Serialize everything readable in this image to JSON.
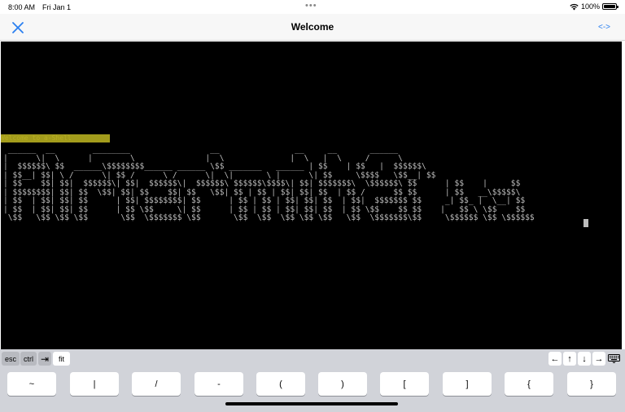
{
  "status_bar": {
    "time": "8:00 AM",
    "date": "Fri Jan 1",
    "battery": "100%"
  },
  "nav": {
    "title": "Welcome",
    "right_action": "<->"
  },
  "terminal": {
    "highlight_text": "Welcome to a-Shell",
    "ascii_art": [
      " ______  __        ________                 __                __     __       ______  ",
      "|      \\|  \\      |        \\               |  \\              |  \\   |  \\     /      \\ ",
      "|  $$$$$$\\ $$  ______\\$$$$$$$$______ ______ \\$$ _______   ______ | $$    | $$   |  $$$$$$\\",
      "| $$__| $$| \\ /      \\| $$ /      \\ /      \\|  \\|       \\ |      \\| $$     \\$$$$   \\$$__| $$",
      "| $$    $$| $$|  $$$$$$\\| $$|  $$$$$$\\|  $$$$$$\\ $$$$$$\\$$$$\\| $$| $$$$$$$\\  \\$$$$$$\\ $$      | $$    |     $$",
      "| $$$$$$$$| $$| $$  \\$$| $$| $$    $$| $$   \\$$| $$ | $$ | $$| $$| $$  | $$ /      $$ $$      | $$   __\\$$$$$\\",
      "| $$  | $$| $$| $$      | $$| $$$$$$$$| $$      | $$ | $$ | $$| $$| $$  | $$|  $$$$$$$ $$     _| $$_ |  \\__| $$",
      "| $$  | $$| $$| $$      | $$ \\$$     \\| $$      | $$ | $$ | $$| $$| $$  | $$ \\$$    $$ $$    |   $$ \\ \\$$    $$",
      " \\$$   \\$$ \\$$ \\$$       \\$$  \\$$$$$$$ \\$$       \\$$  \\$$  \\$$ \\$$ \\$$   \\$$  \\$$$$$$$\\$$     \\$$$$$$ \\$$ \\$$$$$$"
    ]
  },
  "accessory": {
    "esc": "esc",
    "ctrl": "ctrl",
    "tab": "⇥",
    "fit": "fit",
    "arrows": [
      "←",
      "↑",
      "↓",
      "→"
    ]
  },
  "keys": [
    "~",
    "|",
    "/",
    "-",
    "(",
    ")",
    "[",
    "]",
    "{",
    "}"
  ]
}
